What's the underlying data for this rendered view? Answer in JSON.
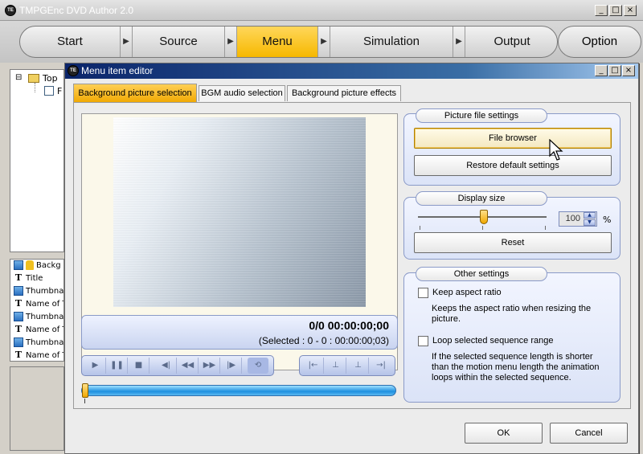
{
  "app": {
    "title": "TMPGEnc DVD Author 2.0",
    "icon_text": "TE"
  },
  "window_controls": {
    "minimize": "_",
    "maximize": "□",
    "close": "×"
  },
  "steps": [
    {
      "label": "Start",
      "active": false
    },
    {
      "label": "Source",
      "active": false
    },
    {
      "label": "Menu",
      "active": true
    },
    {
      "label": "Simulation",
      "active": false
    },
    {
      "label": "Output",
      "active": false
    }
  ],
  "option_button": "Option",
  "tree": {
    "root_label": "Top",
    "child_label": "F",
    "expander": "⊟"
  },
  "item_list": [
    {
      "icon": "picture-icon",
      "label": "Backg",
      "locked": true
    },
    {
      "icon": "text-icon",
      "label": "Title"
    },
    {
      "icon": "picture-icon",
      "label": "Thumbna"
    },
    {
      "icon": "text-icon",
      "label": "Name of T"
    },
    {
      "icon": "picture-icon",
      "label": "Thumbna"
    },
    {
      "icon": "text-icon",
      "label": "Name of T"
    },
    {
      "icon": "picture-icon",
      "label": "Thumbna"
    },
    {
      "icon": "text-icon",
      "label": "Name of T"
    }
  ],
  "dialog": {
    "title": "Menu item editor",
    "tabs": [
      {
        "label": "Background picture selection",
        "active": true
      },
      {
        "label": "BGM audio selection",
        "active": false
      },
      {
        "label": "Background picture effects",
        "active": false
      }
    ],
    "time": {
      "main": "0/0  00:00:00;00",
      "selected": "(Selected : 0 - 0 : 00:00:00;03)"
    },
    "playback_buttons": [
      "play-icon",
      "pause-icon",
      "stop-icon",
      "step-back-icon",
      "rewind-icon",
      "fast-forward-icon",
      "step-forward-icon",
      "loop-icon"
    ],
    "cut_buttons": [
      "go-start-icon",
      "mark-in-icon",
      "mark-out-icon",
      "go-end-icon"
    ],
    "seek_position": 0,
    "picture_file_settings": {
      "label": "Picture file settings",
      "file_browser": "File browser",
      "restore_default": "Restore default settings"
    },
    "display_size": {
      "label": "Display size",
      "value": "100",
      "unit": "%",
      "reset": "Reset",
      "slider_fraction": 0.5
    },
    "other_settings": {
      "label": "Other settings",
      "keep_aspect_label": "Keep aspect ratio",
      "keep_aspect_desc": "Keeps the aspect ratio when resizing the picture.",
      "keep_aspect_checked": false,
      "loop_label": "Loop selected sequence range",
      "loop_desc": "If the selected sequence length is shorter than the motion menu length the animation loops within the selected sequence.",
      "loop_checked": false
    },
    "ok": "OK",
    "cancel": "Cancel"
  }
}
